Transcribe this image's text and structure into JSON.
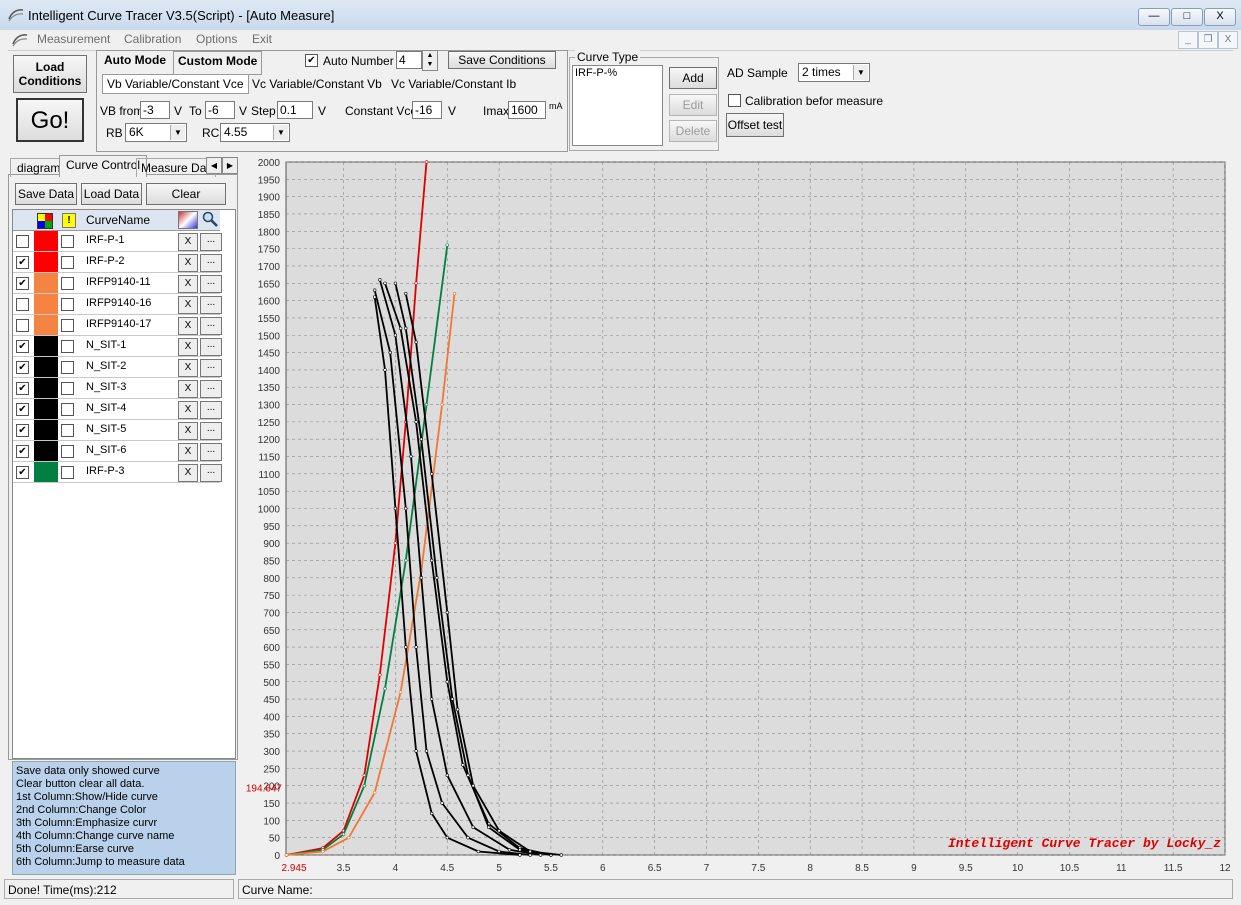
{
  "window": {
    "title": "Intelligent Curve Tracer V3.5(Script) - [Auto Measure]",
    "minimize": "—",
    "maximize": "□",
    "close": "X"
  },
  "menu": [
    "Measurement",
    "Calibration",
    "Options",
    "Exit"
  ],
  "mdi": {
    "min": "_",
    "restore": "❐",
    "close": "X"
  },
  "toolbar": {
    "load_conditions_l1": "Load",
    "load_conditions_l2": "Conditions",
    "go": "Go!"
  },
  "mode_tabs": [
    "Auto Mode",
    "Custom Mode"
  ],
  "variable_tabs": [
    "Vb Variable/Constant Vce",
    "Vc Variable/Constant Vb",
    "Vc Variable/Constant Ib"
  ],
  "params": {
    "vb_from_label": "VB from",
    "vb_from": "-3",
    "v1": "V",
    "to_label": "To",
    "to": "-6",
    "v2": "V",
    "step_label": "Step",
    "step": "0.1",
    "v3": "V",
    "const_vce_label": "Constant Vce",
    "const_vce": "-16",
    "v4": "V",
    "imax_label": "Imax",
    "imax": "1600",
    "ma": "mA",
    "rb_label": "RB",
    "rb": "6K",
    "rc_label": "RC",
    "rc": "4.55"
  },
  "auto_number": {
    "label": "Auto Number",
    "checked": "✔",
    "value": "4"
  },
  "save_conditions": "Save Conditions",
  "curve_type": {
    "legend": "Curve Type",
    "text": "IRF-P-%",
    "add": "Add",
    "edit": "Edit",
    "delete": "Delete"
  },
  "ad_sample": {
    "label": "AD Sample",
    "value": "2 times"
  },
  "calibration": {
    "label": "Calibration befor measure"
  },
  "offset_test": "Offset test",
  "left_tabs": [
    "diagram",
    "Curve Control",
    "Measure Data"
  ],
  "left_buttons": {
    "save": "Save Data",
    "load": "Load Data",
    "clear": "Clear"
  },
  "grid_header": {
    "name": "CurveName",
    "warn": "!"
  },
  "curves": [
    {
      "name": "IRF-P-1",
      "visible": false,
      "color": "#ff0000"
    },
    {
      "name": "IRF-P-2",
      "visible": true,
      "color": "#ff0000"
    },
    {
      "name": "IRFP9140-11",
      "visible": true,
      "color": "#f58442"
    },
    {
      "name": "IRFP9140-16",
      "visible": false,
      "color": "#f58442"
    },
    {
      "name": "IRFP9140-17",
      "visible": false,
      "color": "#f58442"
    },
    {
      "name": "N_SIT-1",
      "visible": true,
      "color": "#000000"
    },
    {
      "name": "N_SIT-2",
      "visible": true,
      "color": "#000000"
    },
    {
      "name": "N_SIT-3",
      "visible": true,
      "color": "#000000"
    },
    {
      "name": "N_SIT-4",
      "visible": true,
      "color": "#000000"
    },
    {
      "name": "N_SIT-5",
      "visible": true,
      "color": "#000000"
    },
    {
      "name": "N_SIT-6",
      "visible": true,
      "color": "#000000"
    },
    {
      "name": "IRF-P-3",
      "visible": true,
      "color": "#008040"
    }
  ],
  "row_buttons": {
    "x": "X",
    "more": "..."
  },
  "help_lines": [
    " Save data only showed curve",
    " Clear button clear all data.",
    "1st Column:Show/Hide curve",
    "2nd Column:Change Color",
    "3th Column:Emphasize curvr",
    "4th Column:Change curve name",
    "5th Column:Earse curve",
    "6th Column:Jump to measure data"
  ],
  "status": {
    "left": "Done!  Time(ms):212",
    "curve_name": "Curve Name:"
  },
  "chart_data": {
    "type": "line",
    "y_ticks": [
      "2000",
      "1950",
      "1900",
      "1850",
      "1800",
      "1750",
      "1700",
      "1650",
      "1600",
      "1550",
      "1500",
      "1450",
      "1400",
      "1350",
      "1300",
      "1250",
      "1200",
      "1150",
      "1100",
      "1050",
      "1000",
      "950",
      "900",
      "850",
      "800",
      "750",
      "700",
      "650",
      "600",
      "550",
      "500",
      "450",
      "400",
      "350",
      "300",
      "250",
      "200",
      "150",
      "100",
      "50",
      "0"
    ],
    "x_ticks": [
      "3.5",
      "4",
      "4.5",
      "5",
      "5.5",
      "6",
      "6.5",
      "7",
      "7.5",
      "8",
      "8.5",
      "9",
      "9.5",
      "10",
      "10.5",
      "11",
      "11.5",
      "12"
    ],
    "xlim": [
      2.945,
      12
    ],
    "ylim": [
      0,
      2000
    ],
    "cursor_x": "2.945",
    "cursor_y": "194.647",
    "watermark": "Intelligent Curve Tracer by Locky_z",
    "grid": true,
    "series": [
      {
        "color": "#e00000",
        "x": [
          2.95,
          3.3,
          3.5,
          3.7,
          3.85,
          4.0,
          4.1,
          4.2,
          4.3
        ],
        "y": [
          0,
          20,
          70,
          230,
          520,
          900,
          1250,
          1650,
          2000
        ]
      },
      {
        "color": "#008040",
        "x": [
          2.95,
          3.3,
          3.5,
          3.7,
          3.9,
          4.1,
          4.3,
          4.5
        ],
        "y": [
          0,
          15,
          60,
          200,
          480,
          850,
          1300,
          1760
        ]
      },
      {
        "color": "#f07830",
        "x": [
          2.95,
          3.3,
          3.55,
          3.8,
          4.05,
          4.25,
          4.45,
          4.57
        ],
        "y": [
          0,
          10,
          50,
          180,
          470,
          820,
          1300,
          1620
        ]
      },
      {
        "color": "#000000",
        "x": [
          3.8,
          3.95,
          4.1,
          4.2,
          4.3,
          4.45,
          4.7,
          5.0,
          5.3
        ],
        "y": [
          1630,
          1450,
          1000,
          600,
          300,
          150,
          50,
          10,
          0
        ]
      },
      {
        "color": "#000000",
        "x": [
          3.85,
          4.0,
          4.15,
          4.25,
          4.35,
          4.5,
          4.75,
          5.1,
          5.4
        ],
        "y": [
          1660,
          1500,
          1150,
          800,
          450,
          230,
          80,
          15,
          0
        ]
      },
      {
        "color": "#000000",
        "x": [
          3.9,
          4.05,
          4.2,
          4.35,
          4.5,
          4.65,
          4.9,
          5.2,
          5.5
        ],
        "y": [
          1650,
          1520,
          1250,
          850,
          500,
          260,
          90,
          20,
          0
        ]
      },
      {
        "color": "#000000",
        "x": [
          4.0,
          4.1,
          4.25,
          4.4,
          4.55,
          4.7,
          4.9,
          5.2,
          5.5
        ],
        "y": [
          1650,
          1520,
          1200,
          800,
          450,
          230,
          80,
          15,
          0
        ]
      },
      {
        "color": "#000000",
        "x": [
          4.1,
          4.2,
          4.35,
          4.5,
          4.6,
          4.75,
          5.0,
          5.3,
          5.6
        ],
        "y": [
          1620,
          1480,
          1100,
          700,
          420,
          200,
          70,
          10,
          0
        ]
      },
      {
        "color": "#000000",
        "x": [
          3.8,
          3.9,
          4.0,
          4.1,
          4.2,
          4.35,
          4.5,
          4.8,
          5.2
        ],
        "y": [
          1610,
          1400,
          1000,
          600,
          300,
          120,
          50,
          10,
          0
        ]
      }
    ]
  }
}
